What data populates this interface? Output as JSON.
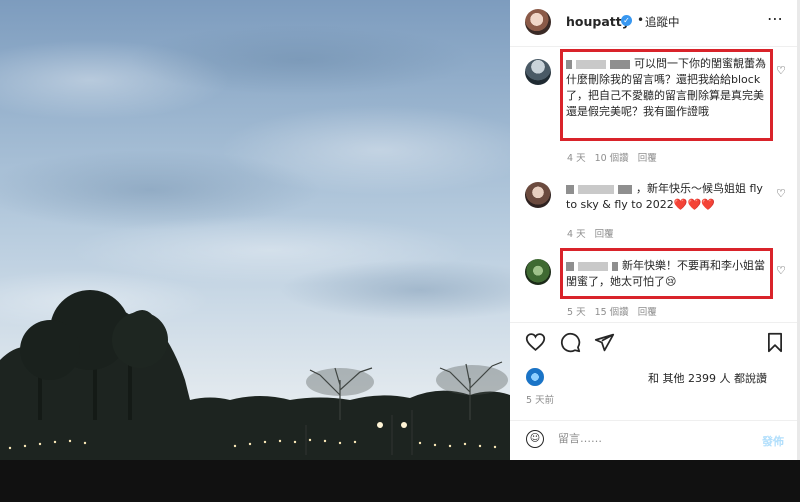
{
  "post": {
    "username": "houpatty",
    "follow_separator": "•",
    "follow_status": "追蹤中",
    "more_label": "⋯"
  },
  "comments": [
    {
      "text": "可以問一下你的閨蜜靚蕾為什麼刪除我的留言嗎？還把我給給block了，把自己不愛聽的留言刪除算是真完美還是假完美呢？我有圖作證哦",
      "time": "4 天",
      "likes": "10 個讚",
      "reply": "回覆",
      "highlighted": true
    },
    {
      "text": "，新年快乐～候鸟姐姐 fly to sky & fly to 2022❤️❤️❤️",
      "time": "4 天",
      "reply": "回覆",
      "highlighted": false
    },
    {
      "text": "新年快樂！不要再和李小姐當閨蜜了，她太可怕了😢",
      "time": "5 天",
      "likes": "15 個讚",
      "reply": "回覆",
      "highlighted": true
    }
  ],
  "likes_text": "和 其他 2399 人 都說讚",
  "time_ago": "5 天前",
  "comment_box": {
    "placeholder": "留言……",
    "post_label": "發佈"
  },
  "colors": {
    "highlight_box": "#d9232a",
    "verified_badge": "#3897f0",
    "post_button_disabled": "#b2dffc"
  },
  "icons": [
    "verified-badge-icon",
    "more-options-icon",
    "heart-icon",
    "comment-icon",
    "share-icon",
    "bookmark-icon",
    "emoji-icon"
  ]
}
